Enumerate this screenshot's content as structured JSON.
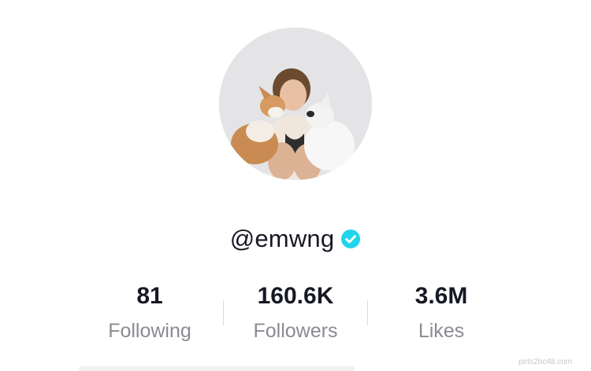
{
  "profile": {
    "username": "@emwng",
    "verified": true,
    "avatar": "profile-photo"
  },
  "stats": [
    {
      "value": "81",
      "label": "Following"
    },
    {
      "value": "160.6K",
      "label": "Followers"
    },
    {
      "value": "3.6M",
      "label": "Likes"
    }
  ],
  "watermark": "pets2bc48.com",
  "colors": {
    "text": "#161823",
    "muted": "#8a8b91",
    "verified": "#20d5ec"
  }
}
